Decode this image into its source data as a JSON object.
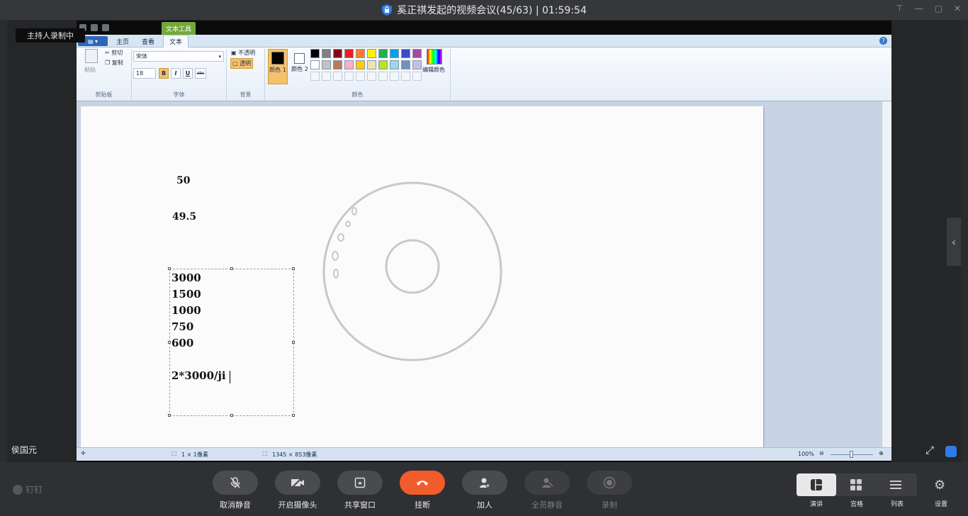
{
  "window": {
    "title": "奚正祺发起的视频会议(45/63) | 01:59:54"
  },
  "recording_badge": "主持人录制中",
  "participant_name": "侯国元",
  "paint": {
    "tool_tab": "文本工具",
    "tabs": [
      "主页",
      "查看",
      "文本"
    ],
    "clipboard": {
      "paste": "粘贴",
      "cut": "剪切",
      "copy": "复制",
      "group": "剪贴板"
    },
    "font": {
      "family": "宋体",
      "size": "18",
      "bold": "B",
      "italic": "I",
      "underline": "U",
      "strike": "abc",
      "group": "字体"
    },
    "background": {
      "opaque": "不透明",
      "transparent": "透明",
      "group": "背景"
    },
    "colors": {
      "color1": "颜色 1",
      "color2": "颜色 2",
      "edit": "编辑颜色",
      "group": "颜色"
    },
    "palette": [
      "#000000",
      "#7f7f7f",
      "#880015",
      "#ed1c24",
      "#ff7f27",
      "#fff200",
      "#22b14c",
      "#00a2e8",
      "#3f48cc",
      "#a349a4",
      "#ffffff",
      "#c3c3c3",
      "#b97a57",
      "#ffaec9",
      "#ffc90e",
      "#efe4b0",
      "#b5e61d",
      "#99d9ea",
      "#7092be",
      "#c8bfe7"
    ],
    "canvas_texts": {
      "a": "50",
      "b": "49.5"
    },
    "textbox_lines": [
      "3000",
      "1500",
      "1000",
      "750",
      "600",
      "",
      "2*3000/ji"
    ],
    "status": {
      "cursor": "1 × 1像素",
      "size": "1345 × 853像素",
      "zoom": "100%"
    }
  },
  "controls": [
    {
      "label": "取消静音",
      "icon": "mic-icon"
    },
    {
      "label": "开启摄像头",
      "icon": "camera-off-icon"
    },
    {
      "label": "共享窗口",
      "icon": "share-icon"
    },
    {
      "label": "挂断",
      "icon": "hangup-icon"
    },
    {
      "label": "加人",
      "icon": "add-user-icon"
    },
    {
      "label": "全员静音",
      "icon": "mute-all-icon"
    },
    {
      "label": "录制",
      "icon": "record-icon"
    }
  ],
  "views": {
    "speaker": "演讲",
    "grid": "宫格",
    "list": "列表",
    "settings": "设置"
  },
  "brand": "钉钉"
}
